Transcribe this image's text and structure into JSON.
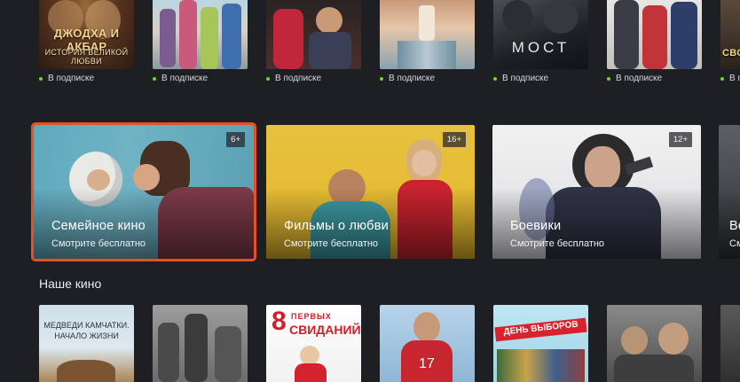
{
  "top_posters": [
    {
      "title_line1": "ДЖОДХА И АКБАР",
      "title_line2": "ИСТОРИЯ ВЕЛИКОЙ ЛЮБВИ",
      "status": "В подписке"
    },
    {
      "title_line1": "",
      "title_line2": "",
      "status": "В подписке"
    },
    {
      "title_line1": "",
      "title_line2": "",
      "status": "В подписке"
    },
    {
      "title_line1": "",
      "title_line2": "",
      "status": "В подписке"
    },
    {
      "title_line1": "МОСТ",
      "title_line2": "",
      "status": "В подписке"
    },
    {
      "title_line1": "",
      "title_line2": "",
      "status": "В подписке"
    },
    {
      "title_line1": "СВО",
      "title_line2": "",
      "status": "В подписке"
    }
  ],
  "genre_cards": [
    {
      "title": "Семейное кино",
      "subtitle": "Смотрите бесплатно",
      "age": "6+"
    },
    {
      "title": "Фильмы о любви",
      "subtitle": "Смотрите бесплатно",
      "age": "16+"
    },
    {
      "title": "Боевики",
      "subtitle": "Смотрите бесплатно",
      "age": "12+"
    },
    {
      "title": "Во",
      "subtitle": "См",
      "age": ""
    }
  ],
  "section": {
    "title": "Наше кино"
  },
  "bottom_posters": [
    {
      "line1": "МЕДВЕДИ КАМЧАТКИ.",
      "line2": "НАЧАЛО ЖИЗНИ"
    },
    {
      "line1": "",
      "line2": ""
    },
    {
      "line1": "8",
      "line2": "ПЕРВЫХ",
      "line3": "СВИДАНИЙ"
    },
    {
      "line1": "",
      "line2": ""
    },
    {
      "line1": "ДЕНЬ ВЫБОРОВ",
      "line2": ""
    },
    {
      "line1": "",
      "line2": ""
    }
  ],
  "colors": {
    "background": "#1e1f23",
    "focus_outline": "#e8501f",
    "subscription_dot": "#7dcb33"
  }
}
